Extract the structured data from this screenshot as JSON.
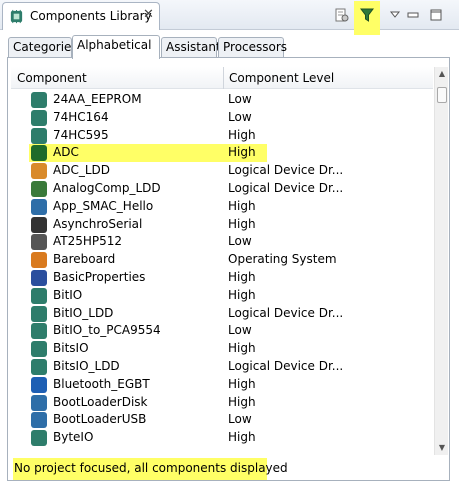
{
  "view": {
    "title": "Components Library",
    "close_glyph": "✕"
  },
  "toolbar": {
    "icons": [
      "document-settings-icon",
      "filter-icon",
      "view-menu-icon",
      "minimize-icon",
      "maximize-icon"
    ]
  },
  "category_tabs": [
    {
      "label": "Categories",
      "active": false
    },
    {
      "label": "Alphabetical",
      "active": true
    },
    {
      "label": "Assistant",
      "active": false
    },
    {
      "label": "Processors",
      "active": false
    }
  ],
  "table": {
    "columns": [
      "Component",
      "Component Level"
    ],
    "rows": [
      {
        "name": "24AA_EEPROM",
        "level": "Low",
        "icon": "chip-icon",
        "color": "#2e7d6b"
      },
      {
        "name": "74HC164",
        "level": "Low",
        "icon": "chip-icon",
        "color": "#2e7d6b"
      },
      {
        "name": "74HC595",
        "level": "High",
        "icon": "chip-icon",
        "color": "#2e7d6b"
      },
      {
        "name": "ADC",
        "level": "High",
        "icon": "adc-icon",
        "color": "#1f6b2a",
        "selected": true
      },
      {
        "name": "ADC_LDD",
        "level": "Logical Device Dr...",
        "icon": "waveform-icon",
        "color": "#d98a2b"
      },
      {
        "name": "AnalogComp_LDD",
        "level": "Logical Device Dr...",
        "icon": "comparator-icon",
        "color": "#3a7a3a"
      },
      {
        "name": "App_SMAC_Hello",
        "level": "High",
        "icon": "hello-icon",
        "color": "#2e6ea8"
      },
      {
        "name": "AsynchroSerial",
        "level": "High",
        "icon": "serial-icon",
        "color": "#333333"
      },
      {
        "name": "AT25HP512",
        "level": "Low",
        "icon": "chip-icon",
        "color": "#555555"
      },
      {
        "name": "Bareboard",
        "level": "Operating System",
        "icon": "os-icon",
        "color": "#d97a1e"
      },
      {
        "name": "BasicProperties",
        "level": "High",
        "icon": "usb-icon",
        "color": "#2b4f9e"
      },
      {
        "name": "BitIO",
        "level": "High",
        "icon": "pin-icon",
        "color": "#2e7d6b"
      },
      {
        "name": "BitIO_LDD",
        "level": "Logical Device Dr...",
        "icon": "pin-icon",
        "color": "#2e7d6b"
      },
      {
        "name": "BitIO_to_PCA9554",
        "level": "Low",
        "icon": "pin-icon",
        "color": "#2e7d6b"
      },
      {
        "name": "BitsIO",
        "level": "High",
        "icon": "pins-icon",
        "color": "#2e7d6b"
      },
      {
        "name": "BitsIO_LDD",
        "level": "Logical Device Dr...",
        "icon": "pins-icon",
        "color": "#2e7d6b"
      },
      {
        "name": "Bluetooth_EGBT",
        "level": "High",
        "icon": "bluetooth-icon",
        "color": "#1e5fb4"
      },
      {
        "name": "BootLoaderDisk",
        "level": "High",
        "icon": "bld-icon",
        "color": "#2e6ea8"
      },
      {
        "name": "BootLoaderUSB",
        "level": "Low",
        "icon": "usb-icon",
        "color": "#2e6ea8"
      },
      {
        "name": "ByteIO",
        "level": "High",
        "icon": "byte-icon",
        "color": "#2e7d6b"
      }
    ]
  },
  "status": {
    "text": "No project focused, all components displayed"
  },
  "colors": {
    "highlight": "#ffff66",
    "frame": "#a7b1bd"
  }
}
